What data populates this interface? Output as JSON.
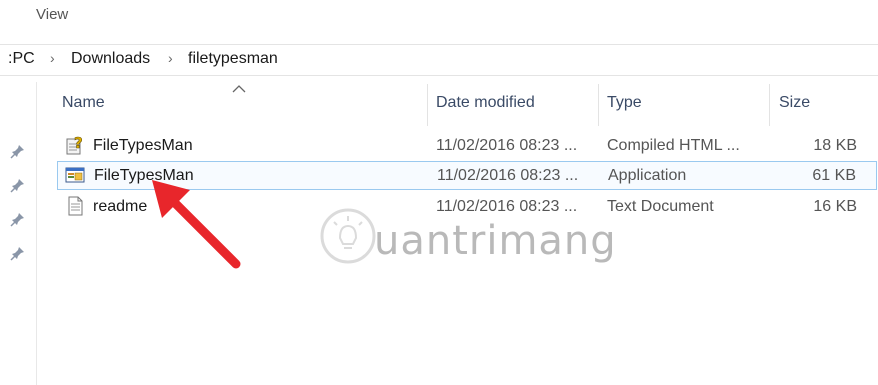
{
  "ribbon": {
    "view_label": "View"
  },
  "address_bar": {
    "crumbs": [
      "PC",
      "Downloads",
      "filetypesman"
    ]
  },
  "columns": {
    "name": "Name",
    "date_modified": "Date modified",
    "type": "Type",
    "size": "Size"
  },
  "files": [
    {
      "name": "FileTypesMan",
      "date": "11/02/2016 08:23 ...",
      "type": "Compiled HTML ...",
      "size": "18 KB",
      "icon": "chm-help-icon",
      "selected": false
    },
    {
      "name": "FileTypesMan",
      "date": "11/02/2016 08:23 ...",
      "type": "Application",
      "size": "61 KB",
      "icon": "application-icon",
      "selected": true
    },
    {
      "name": "readme",
      "date": "11/02/2016 08:23 ...",
      "type": "Text Document",
      "size": "16 KB",
      "icon": "text-document-icon",
      "selected": false
    }
  ],
  "watermark": {
    "text": "uantrimang"
  },
  "colors": {
    "selection_border": "#9ac9ef",
    "arrow": "#e8262b",
    "header_text": "#3a4a66"
  }
}
